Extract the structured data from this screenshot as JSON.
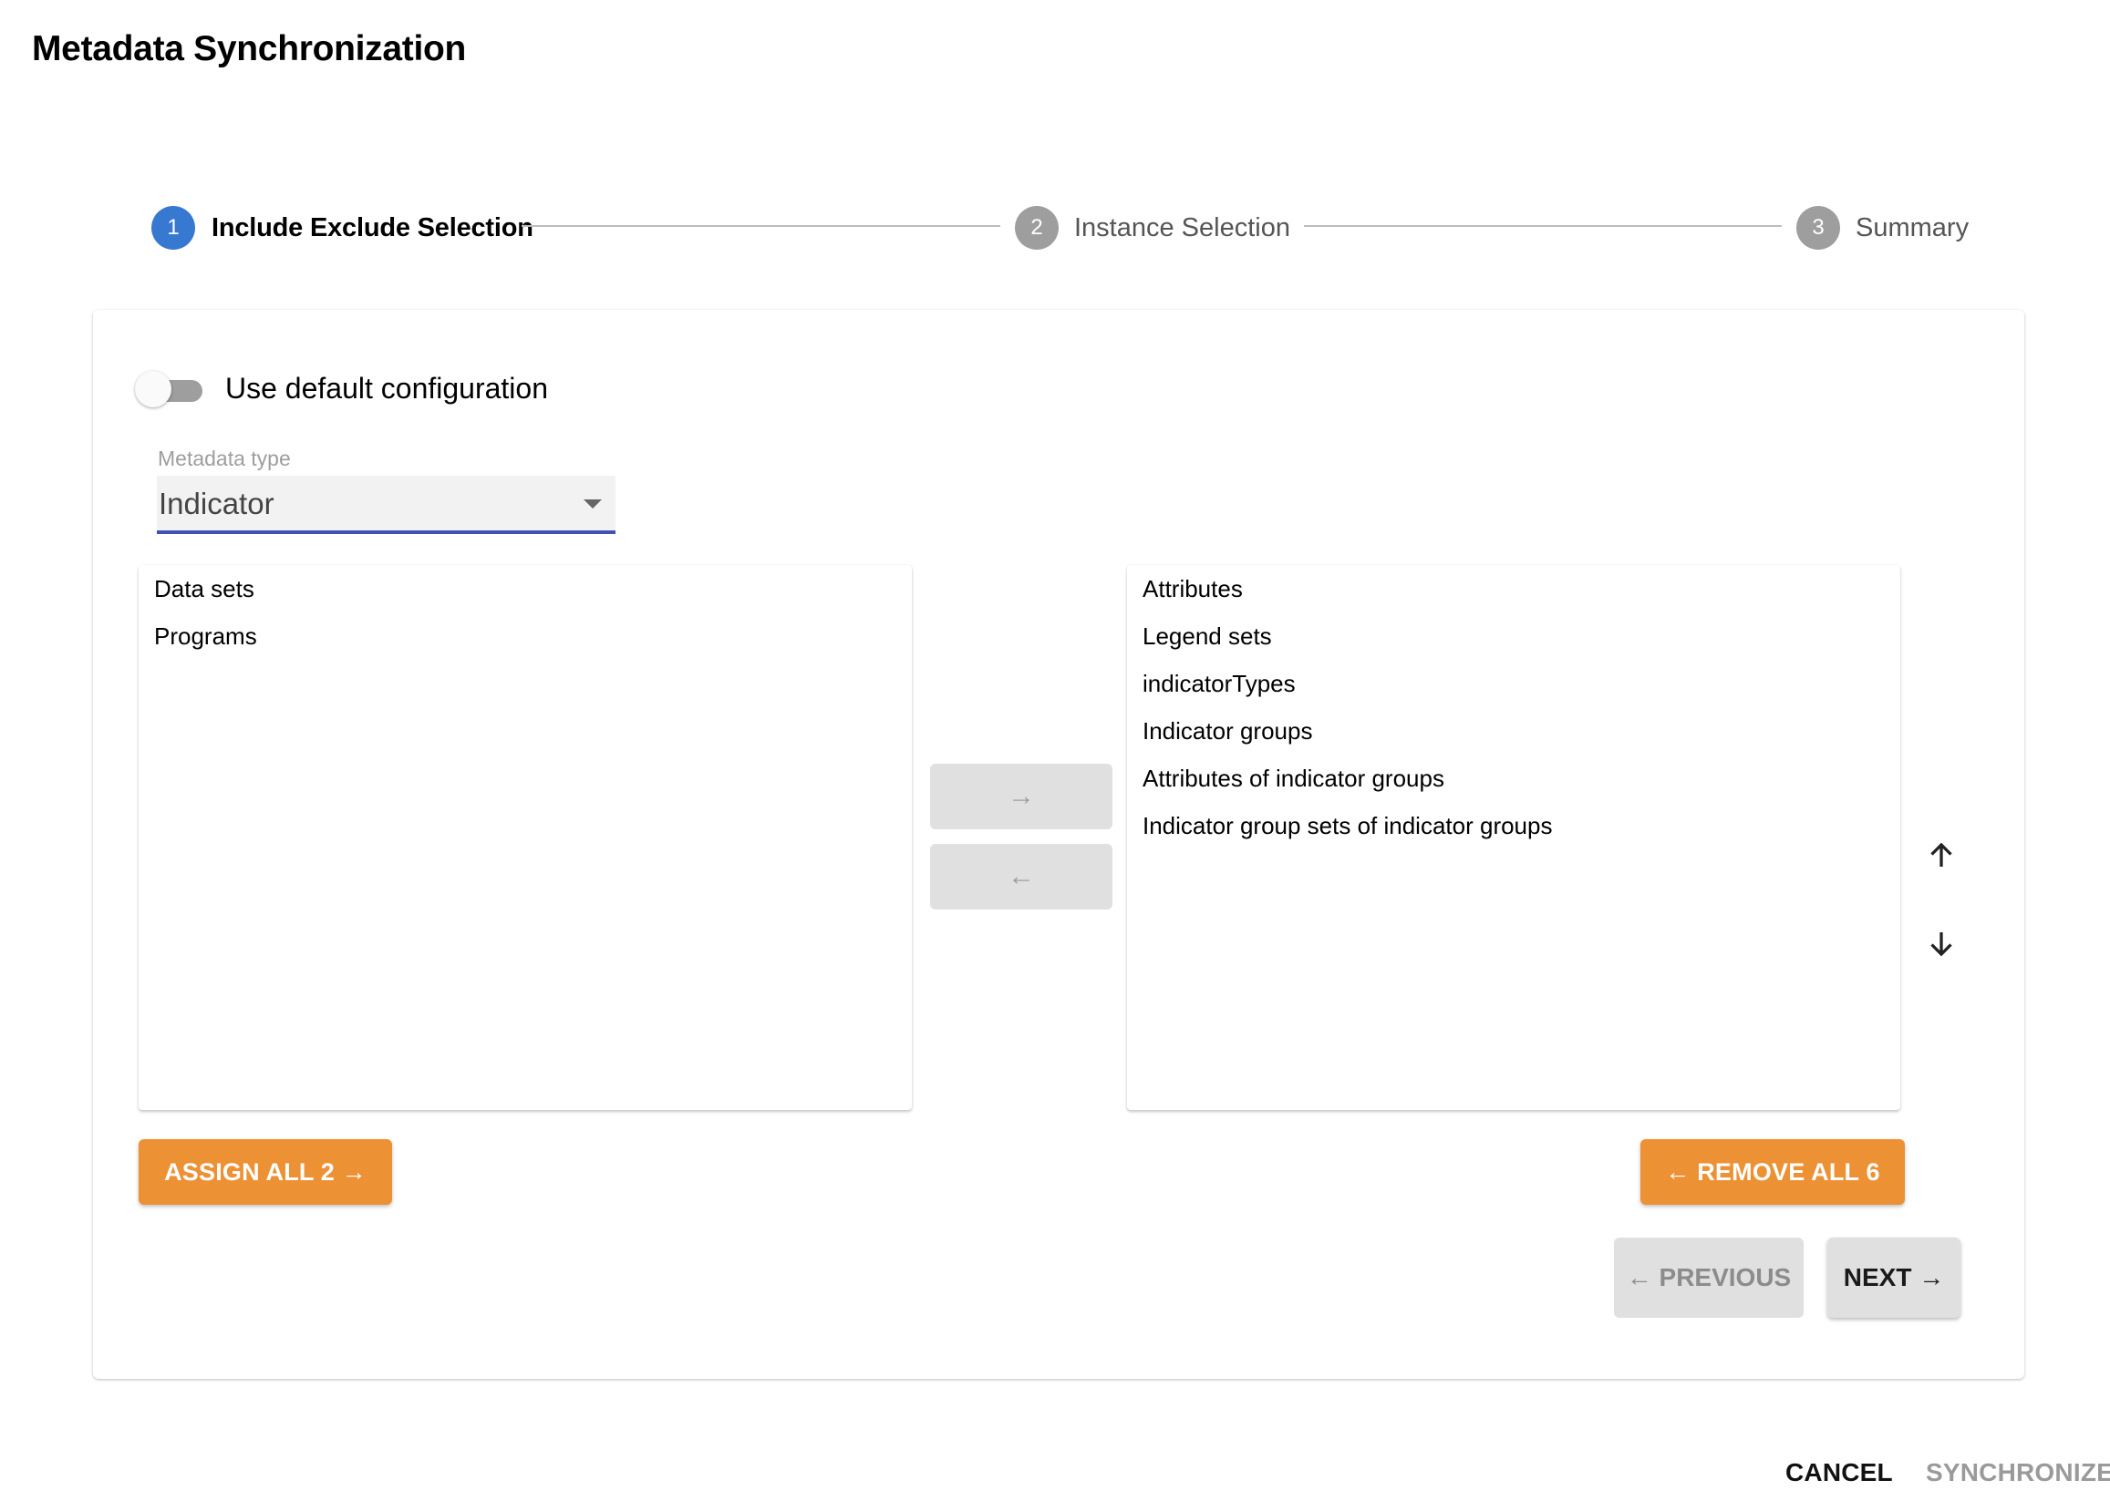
{
  "page": {
    "title": "Metadata Synchronization"
  },
  "stepper": {
    "steps": [
      {
        "number": "1",
        "label": "Include Exclude Selection",
        "state": "active"
      },
      {
        "number": "2",
        "label": "Instance Selection",
        "state": "inactive"
      },
      {
        "number": "3",
        "label": "Summary",
        "state": "inactive"
      }
    ]
  },
  "config": {
    "toggle_label": "Use default configuration",
    "toggle_on": false
  },
  "metadata_type": {
    "label": "Metadata type",
    "value": "Indicator"
  },
  "transfer": {
    "available": {
      "items": [
        "Data sets",
        "Programs"
      ]
    },
    "selected": {
      "items": [
        "Attributes",
        "Legend sets",
        "indicatorTypes",
        "Indicator groups",
        "Attributes of indicator groups",
        "Indicator group sets of indicator groups"
      ]
    },
    "move_right_icon": "→",
    "move_left_icon": "←",
    "move_up_icon": "arrow-up-icon",
    "move_down_icon": "arrow-down-icon",
    "assign_all_label": "ASSIGN ALL 2 →",
    "remove_all_label": "← REMOVE ALL 6"
  },
  "navigation": {
    "previous_label": "← PREVIOUS",
    "next_label": "NEXT →"
  },
  "footer": {
    "cancel_label": "CANCEL",
    "synchronize_label": "SYNCHRONIZE"
  },
  "colors": {
    "step_active": "#3778d1",
    "step_inactive": "#9e9e9e",
    "accent_orange": "#ed9135",
    "select_underline": "#3f51b5"
  }
}
